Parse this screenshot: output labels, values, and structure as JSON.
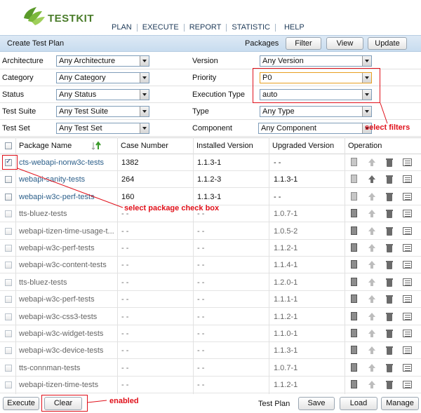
{
  "app": {
    "logo_text": "TESTKIT"
  },
  "nav": [
    "PLAN",
    "EXECUTE",
    "REPORT",
    "STATISTIC",
    "HELP"
  ],
  "titlebar": {
    "title": "Create Test Plan",
    "packages_label": "Packages",
    "filter_button": "Filter",
    "view_button": "View",
    "update_button": "Update"
  },
  "filters": {
    "architecture": {
      "label": "Architecture",
      "value": "Any Architecture"
    },
    "version": {
      "label": "Version",
      "value": "Any Version"
    },
    "category": {
      "label": "Category",
      "value": "Any Category"
    },
    "priority": {
      "label": "Priority",
      "value": "P0"
    },
    "status": {
      "label": "Status",
      "value": "Any Status"
    },
    "execution_type": {
      "label": "Execution Type",
      "value": "auto"
    },
    "test_suite": {
      "label": "Test Suite",
      "value": "Any Test Suite"
    },
    "type": {
      "label": "Type",
      "value": "Any Type"
    },
    "test_set": {
      "label": "Test Set",
      "value": "Any Test Set"
    },
    "component": {
      "label": "Component",
      "value": "Any Component"
    }
  },
  "table": {
    "headers": {
      "package_name": "Package Name",
      "case_number": "Case Number",
      "installed_version": "Installed Version",
      "upgraded_version": "Upgraded Version",
      "operation": "Operation"
    },
    "rows": [
      {
        "name": "cts-webapi-nonw3c-tests",
        "cases": "1382",
        "installed": "1.1.3-1",
        "upgraded": "- -",
        "checked": true,
        "installed_pkg": true
      },
      {
        "name": "webapi-sanity-tests",
        "cases": "264",
        "installed": "1.1.2-3",
        "upgraded": "1.1.3-1",
        "checked": false,
        "installed_pkg": true
      },
      {
        "name": "webapi-w3c-perf-tests",
        "cases": "160",
        "installed": "1.1.3-1",
        "upgraded": "- -",
        "checked": false,
        "installed_pkg": true
      },
      {
        "name": "tts-bluez-tests",
        "cases": "- -",
        "installed": "- -",
        "upgraded": "1.0.7-1",
        "checked": false,
        "installed_pkg": false
      },
      {
        "name": "webapi-tizen-time-usage-t...",
        "cases": "- -",
        "installed": "- -",
        "upgraded": "1.0.5-2",
        "checked": false,
        "installed_pkg": false
      },
      {
        "name": "webapi-w3c-perf-tests",
        "cases": "- -",
        "installed": "- -",
        "upgraded": "1.1.2-1",
        "checked": false,
        "installed_pkg": false
      },
      {
        "name": "webapi-w3c-content-tests",
        "cases": "- -",
        "installed": "- -",
        "upgraded": "1.1.4-1",
        "checked": false,
        "installed_pkg": false
      },
      {
        "name": "tts-bluez-tests",
        "cases": "- -",
        "installed": "- -",
        "upgraded": "1.2.0-1",
        "checked": false,
        "installed_pkg": false
      },
      {
        "name": "webapi-w3c-perf-tests",
        "cases": "- -",
        "installed": "- -",
        "upgraded": "1.1.1-1",
        "checked": false,
        "installed_pkg": false
      },
      {
        "name": "webapi-w3c-css3-tests",
        "cases": "- -",
        "installed": "- -",
        "upgraded": "1.1.2-1",
        "checked": false,
        "installed_pkg": false
      },
      {
        "name": "webapi-w3c-widget-tests",
        "cases": "- -",
        "installed": "- -",
        "upgraded": "1.1.0-1",
        "checked": false,
        "installed_pkg": false
      },
      {
        "name": "webapi-w3c-device-tests",
        "cases": "- -",
        "installed": "- -",
        "upgraded": "1.1.3-1",
        "checked": false,
        "installed_pkg": false
      },
      {
        "name": "tts-connman-tests",
        "cases": "- -",
        "installed": "- -",
        "upgraded": "1.0.7-1",
        "checked": false,
        "installed_pkg": false
      },
      {
        "name": "webapi-tizen-time-tests",
        "cases": "- -",
        "installed": "- -",
        "upgraded": "1.1.2-1",
        "checked": false,
        "installed_pkg": false
      }
    ]
  },
  "footer": {
    "execute_button": "Execute",
    "clear_button": "Clear",
    "test_plan_label": "Test Plan",
    "save_button": "Save",
    "load_button": "Load",
    "manage_button": "Manage"
  },
  "annotations": {
    "select_filters": "select filters",
    "select_package": "select package check box",
    "enabled": "enabled"
  },
  "colors": {
    "annotation": "#e0101a",
    "link": "#2c5f8a",
    "titlebar": "#c8dcef"
  }
}
